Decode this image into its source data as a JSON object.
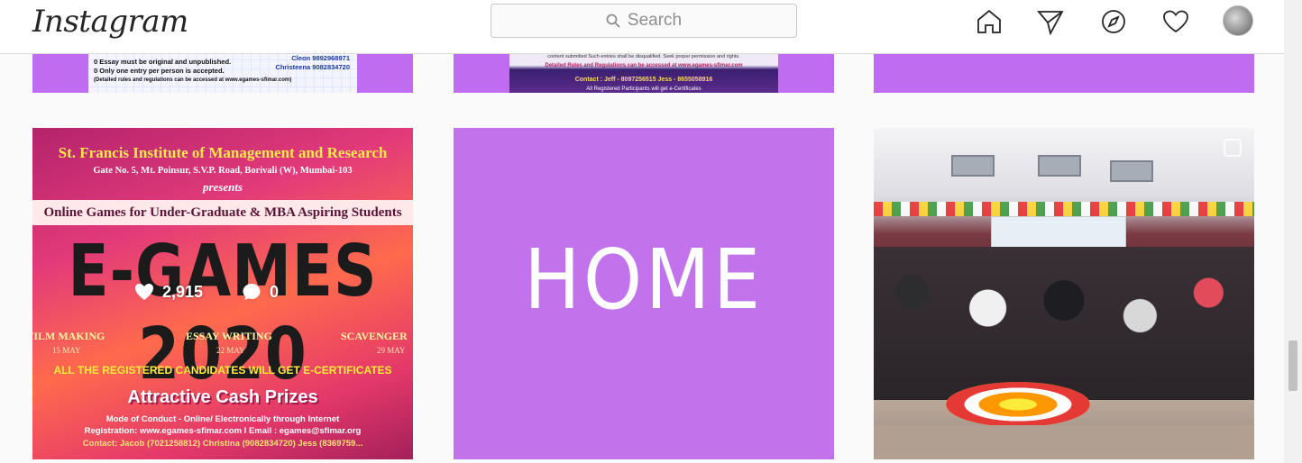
{
  "header": {
    "logo": "Instagram",
    "search_placeholder": "Search",
    "nav": [
      "home-icon",
      "direct-icon",
      "explore-icon",
      "activity-icon",
      "profile-avatar"
    ]
  },
  "colors": {
    "tile_purple": "#c273ec",
    "notification_dot": "#ed4956",
    "text": "#262626"
  },
  "grid": {
    "row1": {
      "post1": {
        "lines": [
          "0 Essay must be original and unpublished.",
          "0 Only one entry per person is accepted.",
          "(Detailed rules and regulations can be accessed at www.egames-sfimar.com)"
        ],
        "contact1": "Cleon   9892968971",
        "contact2": "Christeena 9082834720"
      },
      "post2": {
        "line1": "content submitted Such entries shall be disqualified.   Seek proper permission and rights.",
        "line2": "Detailed Rules and Regulations can be accessed at www.egames-sfimar.com",
        "line3": "Contact : Jeff - 8097256515                   Jess - 8655058916",
        "line4": "All Registered Participants will get e-Certificates"
      }
    },
    "post4": {
      "institute": "St. Francis Institute of Management and Research",
      "address": "Gate No. 5, Mt. Poinsur, S.V.P. Road, Borivali (W), Mumbai-103",
      "presents": "presents",
      "banner": "Online Games for Under-Graduate & MBA Aspiring Students",
      "title": "E-GAMES 2020",
      "likes": "2,915",
      "comments": "0",
      "events": [
        {
          "name": "FILM MAKING",
          "date": "15 MAY"
        },
        {
          "name": "ESSAY WRITING",
          "date": "22 MAY"
        },
        {
          "name": "SCAVENGER",
          "date": "29 MAY"
        }
      ],
      "certificate": "ALL THE REGISTERED CANDIDATES WILL GET E-CERTIFICATES",
      "prizes": "Attractive Cash Prizes",
      "mode": "Mode of Conduct - Online/ Electronically through Internet",
      "registration": "Registration: www.egames-sfimar.com   I   Email : egames@sfimar.org",
      "contact": "Contact: Jacob (7021258812)  Christina (9082834720)  Jess (8369759..."
    },
    "post5": {
      "text": "HOME"
    }
  }
}
